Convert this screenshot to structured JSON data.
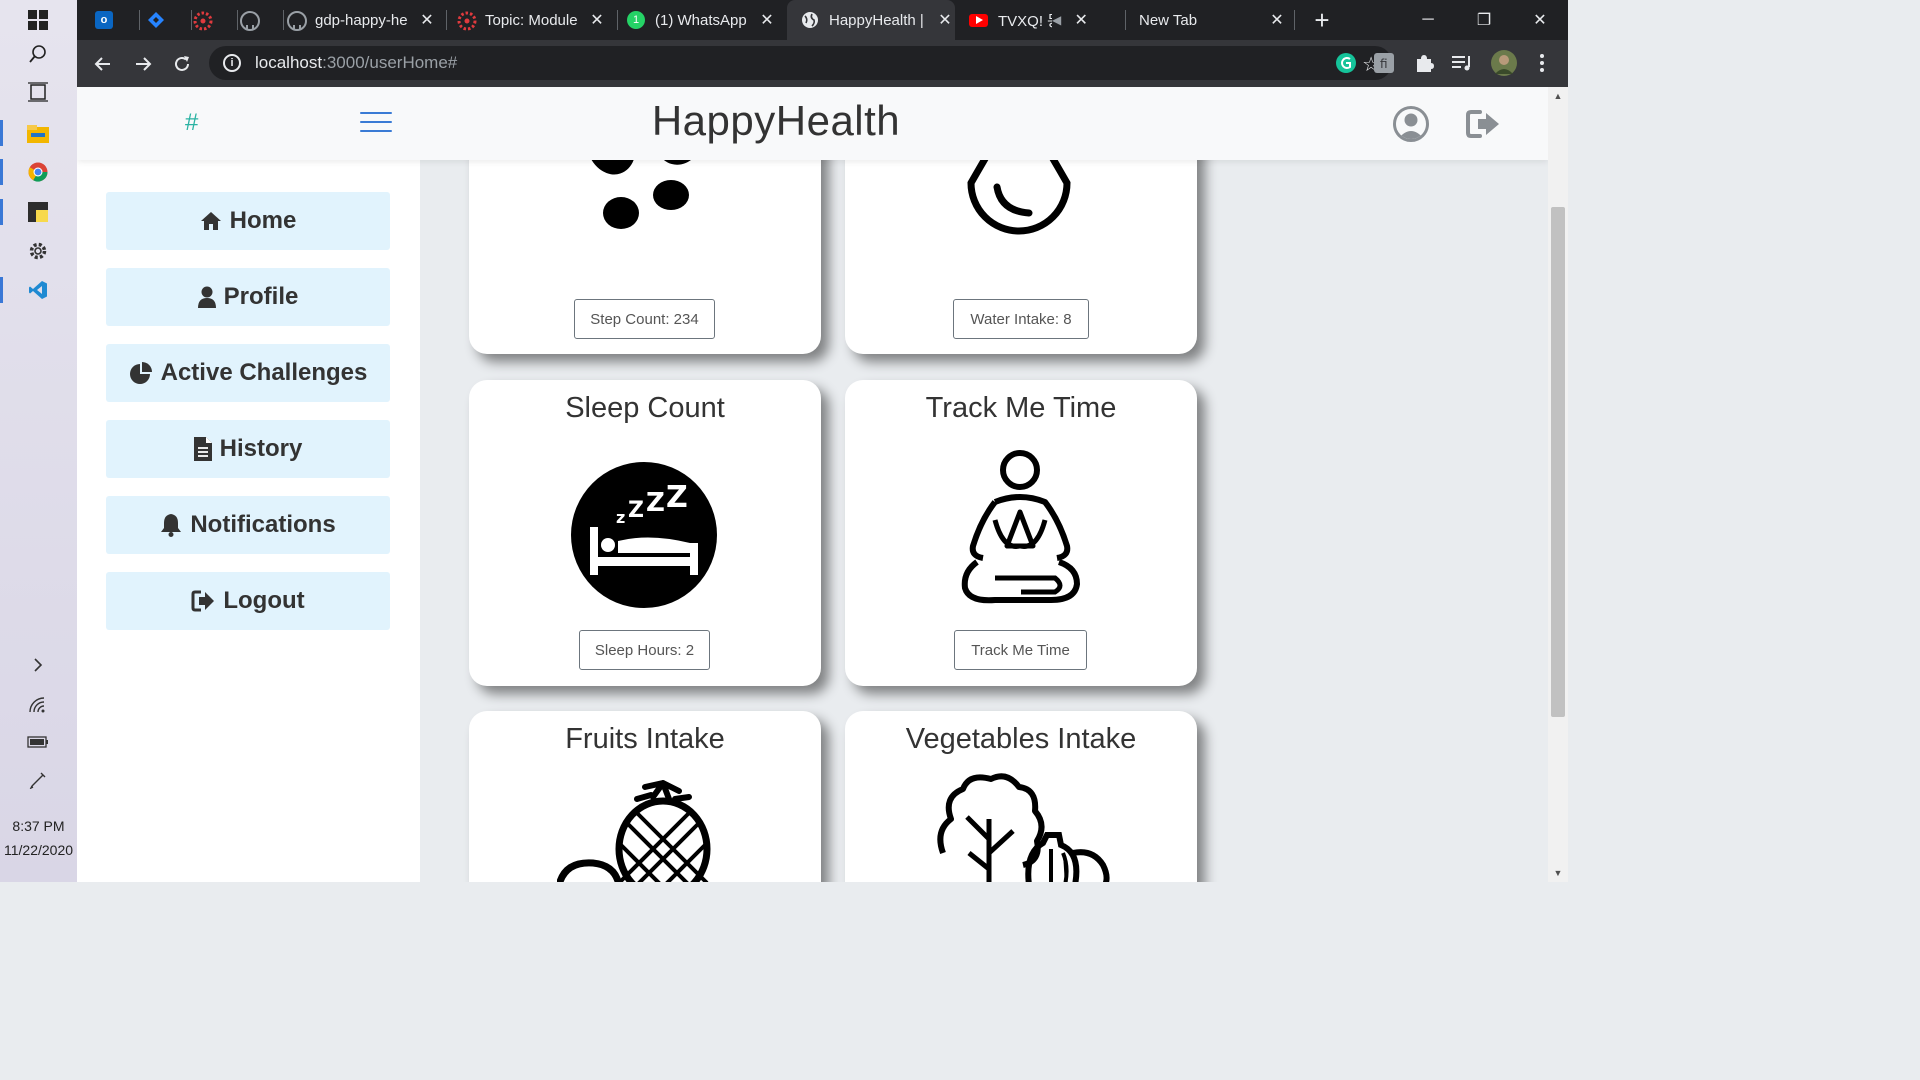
{
  "taskbar": {
    "time": "8:37 PM",
    "date": "11/22/2020"
  },
  "browser": {
    "tabs": [
      {
        "title": "",
        "color": "#0a66c2"
      },
      {
        "title": "",
        "color": "#2684ff"
      },
      {
        "title": "",
        "color": "#e03a3e"
      },
      {
        "title": "",
        "color": "#e8eaed"
      },
      {
        "title": "gdp-happy-he",
        "color": "#e8eaed"
      },
      {
        "title": "Topic: Module",
        "color": "#e03a3e"
      },
      {
        "title": "(1) WhatsApp",
        "color": "#25d366"
      },
      {
        "title": "HappyHealth |",
        "color": "#e8eaed"
      },
      {
        "title": "TVXQ! 동",
        "color": "#ff0000"
      },
      {
        "title": "New Tab",
        "color": "#e8eaed"
      }
    ],
    "url_host": "localhost",
    "url_path": ":3000/userHome#"
  },
  "app": {
    "brand": "HappyHealth",
    "sidebar": [
      {
        "label": "Home",
        "icon": "home-icon"
      },
      {
        "label": "Profile",
        "icon": "user-icon"
      },
      {
        "label": "Active Challenges",
        "icon": "pie-chart-icon"
      },
      {
        "label": "History",
        "icon": "document-icon"
      },
      {
        "label": "Notifications",
        "icon": "bell-icon"
      },
      {
        "label": "Logout",
        "icon": "sign-out-icon"
      }
    ],
    "cards": [
      {
        "title": "",
        "button": "Step Count: 234",
        "icon": "footprints-icon"
      },
      {
        "title": "",
        "button": "Water Intake: 8",
        "icon": "water-drop-icon"
      },
      {
        "title": "Sleep Count",
        "button": "Sleep Hours: 2",
        "icon": "sleep-icon"
      },
      {
        "title": "Track Me Time",
        "button": "Track Me Time",
        "icon": "meditation-icon"
      },
      {
        "title": "Fruits Intake",
        "button": "",
        "icon": "pineapple-icon"
      },
      {
        "title": "Vegetables Intake",
        "button": "",
        "icon": "vegetables-icon"
      }
    ]
  }
}
